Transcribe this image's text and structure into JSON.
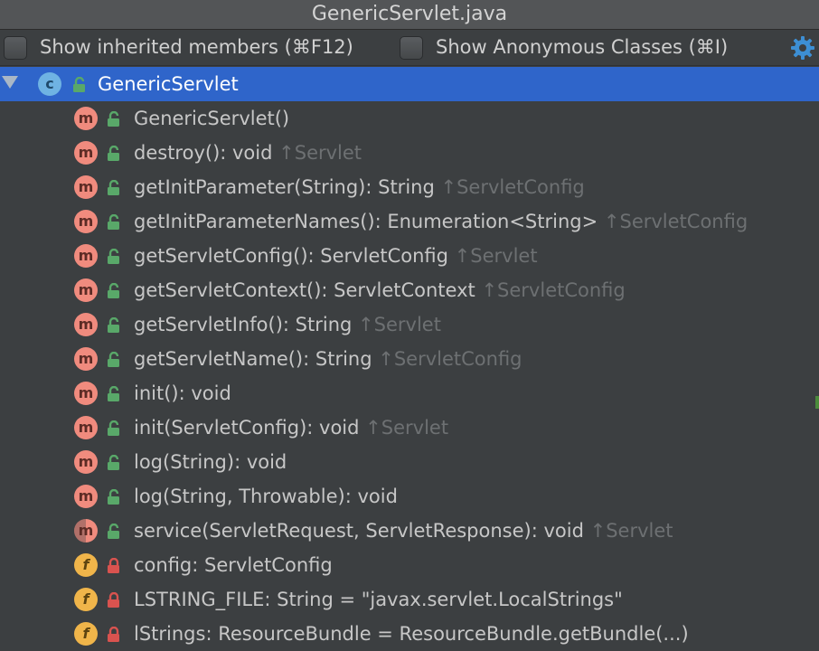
{
  "window": {
    "title": "GenericServlet.java"
  },
  "toolbar": {
    "show_inherited_label": "Show inherited members (⌘F12)",
    "show_anonymous_label": "Show Anonymous Classes (⌘I)"
  },
  "colors": {
    "selection": "#2f65ca",
    "method_badge": "#f08b7e",
    "field_badge": "#f0b54a",
    "public_lock": "#59a869",
    "private_lock": "#d9534f"
  },
  "tree": {
    "root": {
      "name": "GenericServlet",
      "icon": "class-icon"
    },
    "members": [
      {
        "kind": "method",
        "access": "public",
        "sig": "GenericServlet()",
        "inherited": ""
      },
      {
        "kind": "method",
        "access": "public",
        "sig": "destroy(): void",
        "inherited": "↑Servlet"
      },
      {
        "kind": "method",
        "access": "public",
        "sig": "getInitParameter(String): String",
        "inherited": "↑ServletConfig"
      },
      {
        "kind": "method",
        "access": "public",
        "sig": "getInitParameterNames(): Enumeration<String>",
        "inherited": "↑ServletConfig"
      },
      {
        "kind": "method",
        "access": "public",
        "sig": "getServletConfig(): ServletConfig",
        "inherited": "↑Servlet"
      },
      {
        "kind": "method",
        "access": "public",
        "sig": "getServletContext(): ServletContext",
        "inherited": "↑ServletConfig"
      },
      {
        "kind": "method",
        "access": "public",
        "sig": "getServletInfo(): String",
        "inherited": "↑Servlet"
      },
      {
        "kind": "method",
        "access": "public",
        "sig": "getServletName(): String",
        "inherited": "↑ServletConfig"
      },
      {
        "kind": "method",
        "access": "public",
        "sig": "init(): void",
        "inherited": ""
      },
      {
        "kind": "method",
        "access": "public",
        "sig": "init(ServletConfig): void",
        "inherited": "↑Servlet"
      },
      {
        "kind": "method",
        "access": "public",
        "sig": "log(String): void",
        "inherited": ""
      },
      {
        "kind": "method",
        "access": "public",
        "sig": "log(String, Throwable): void",
        "inherited": ""
      },
      {
        "kind": "abstract-method",
        "access": "public",
        "sig": "service(ServletRequest, ServletResponse): void",
        "inherited": "↑Servlet"
      },
      {
        "kind": "field",
        "access": "private",
        "sig": "config: ServletConfig",
        "inherited": ""
      },
      {
        "kind": "static-field",
        "access": "private",
        "sig": "LSTRING_FILE: String = \"javax.servlet.LocalStrings\"",
        "inherited": ""
      },
      {
        "kind": "static-field",
        "access": "private",
        "sig": "lStrings: ResourceBundle = ResourceBundle.getBundle(...)",
        "inherited": ""
      }
    ]
  }
}
